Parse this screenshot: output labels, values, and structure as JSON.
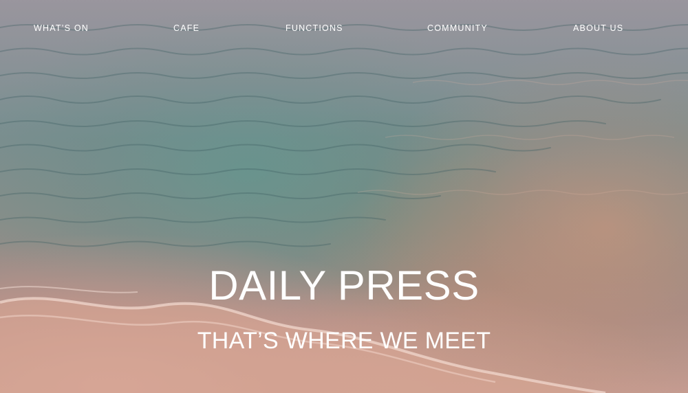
{
  "nav": {
    "items": [
      {
        "label": "WHAT’S ON"
      },
      {
        "label": "CAFE"
      },
      {
        "label": "FUNCTIONS"
      },
      {
        "label": "COMMUNITY"
      },
      {
        "label": "ABOUT US"
      }
    ]
  },
  "hero": {
    "title": "DAILY PRESS",
    "tagline": "THAT’S WHERE WE MEET"
  },
  "colors": {
    "text": "#ffffff",
    "water": "#6f8f8f",
    "sand": "#d7a596",
    "tint": "#c8a0aa"
  }
}
